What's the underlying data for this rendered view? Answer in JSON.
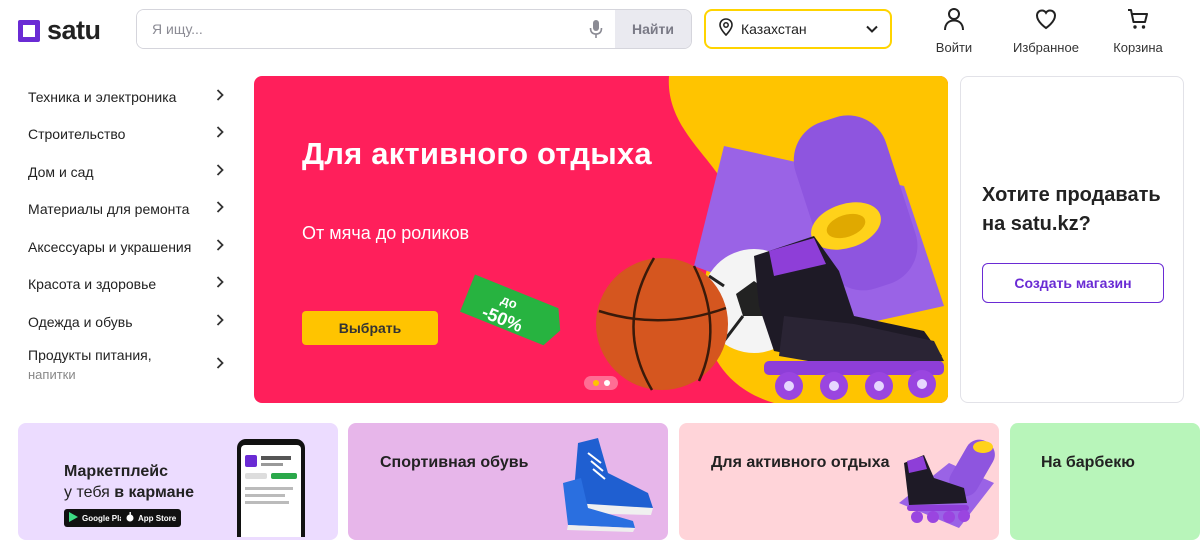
{
  "header": {
    "logo_text": "satu",
    "search_placeholder": "Я ищу...",
    "search_button": "Найти",
    "region": "Казахстан",
    "actions": {
      "login": "Войти",
      "favorites": "Избранное",
      "cart": "Корзина"
    }
  },
  "sidebar": {
    "categories": [
      {
        "label": "Техника и электроника"
      },
      {
        "label": "Строительство"
      },
      {
        "label": "Дом и сад"
      },
      {
        "label": "Материалы для ремонта"
      },
      {
        "label": "Аксессуары и украшения"
      },
      {
        "label": "Красота и здоровье"
      },
      {
        "label": "Одежда и обувь"
      },
      {
        "label": "Продукты питания,",
        "sub": "напитки"
      }
    ]
  },
  "hero": {
    "title": "Для активного отдыха",
    "subtitle": "От мяча до роликов",
    "discount_top": "до",
    "discount_value": "-50%",
    "button": "Выбрать",
    "slides": 2,
    "active_slide": 1
  },
  "seller": {
    "title": "Хотите продавать на satu.kz?",
    "button": "Создать магазин"
  },
  "promos": {
    "app": {
      "line1": "Маркетплейс",
      "line2_prefix": "у тебя ",
      "line2_bold": "в кармане",
      "google_play": "Google Play",
      "app_store": "App Store"
    },
    "shoes": "Спортивная обувь",
    "active": "Для активного отдыха",
    "bbq": "На барбекю"
  },
  "colors": {
    "brand": "#6a2bd4",
    "accent_yellow": "#ffc400",
    "hero_bg": "#ff1f5b"
  }
}
